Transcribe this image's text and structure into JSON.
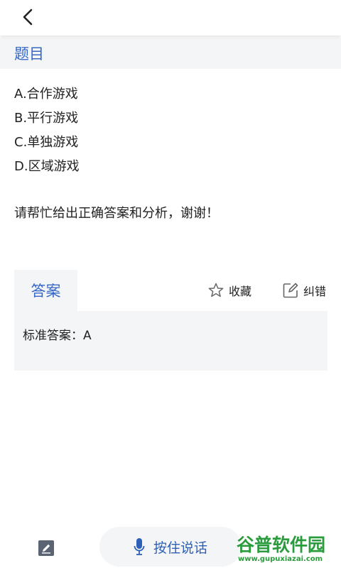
{
  "header": {
    "back_icon": "chevron-left-icon"
  },
  "section": {
    "title": "题目"
  },
  "question": {
    "options": [
      "A.合作游戏",
      "B.平行游戏",
      "C.单独游戏",
      "D.区域游戏"
    ],
    "request": "请帮忙给出正确答案和分析，谢谢！"
  },
  "answer": {
    "tab_label": "答案",
    "favorite_label": "收藏",
    "correct_label": "纠错",
    "content": "标准答案：A"
  },
  "bottom": {
    "voice_label": "按住说话"
  },
  "watermark": {
    "brand": "谷普软件园",
    "url": "www.gupuxiazai.com"
  },
  "colors": {
    "accent": "#3567c4",
    "panel_bg": "#f4f5f7",
    "watermark_green": "#2b9c3d"
  }
}
